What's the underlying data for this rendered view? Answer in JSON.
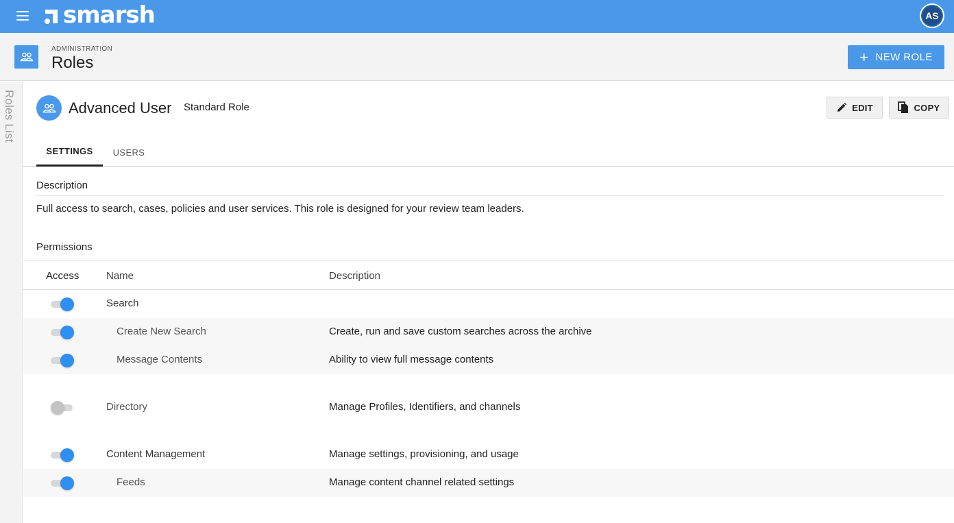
{
  "topbar": {
    "brand": "smarsh",
    "avatar_initials": "AS",
    "accent_color": "#4a98ea"
  },
  "page_header": {
    "overline": "ADMINISTRATION",
    "title": "Roles",
    "new_role_label": "NEW ROLE"
  },
  "siderail": {
    "label": "Roles List"
  },
  "role": {
    "name": "Advanced User",
    "type": "Standard Role",
    "edit_label": "EDIT",
    "copy_label": "COPY"
  },
  "tabs": [
    {
      "label": "SETTINGS",
      "active": true
    },
    {
      "label": "USERS",
      "active": false
    }
  ],
  "description": {
    "heading": "Description",
    "text": "Full access to search, cases, policies and user services. This role is designed for your review team leaders."
  },
  "permissions": {
    "heading": "Permissions",
    "columns": {
      "access": "Access",
      "name": "Name",
      "description": "Description"
    },
    "rows": [
      {
        "name": "Search",
        "description": "",
        "enabled": true,
        "level": "parent"
      },
      {
        "name": "Create New Search",
        "description": "Create, run and save custom searches across the archive",
        "enabled": true,
        "level": "child"
      },
      {
        "name": "Message Contents",
        "description": "Ability to view full message contents",
        "enabled": true,
        "level": "child"
      },
      {
        "name": "Directory",
        "description": "Manage Profiles, Identifiers, and channels",
        "enabled": false,
        "level": "parent"
      },
      {
        "name": "Content Management",
        "description": "Manage settings, provisioning, and usage",
        "enabled": true,
        "level": "parent"
      },
      {
        "name": "Feeds",
        "description": "Manage content channel related settings",
        "enabled": true,
        "level": "child"
      }
    ]
  }
}
